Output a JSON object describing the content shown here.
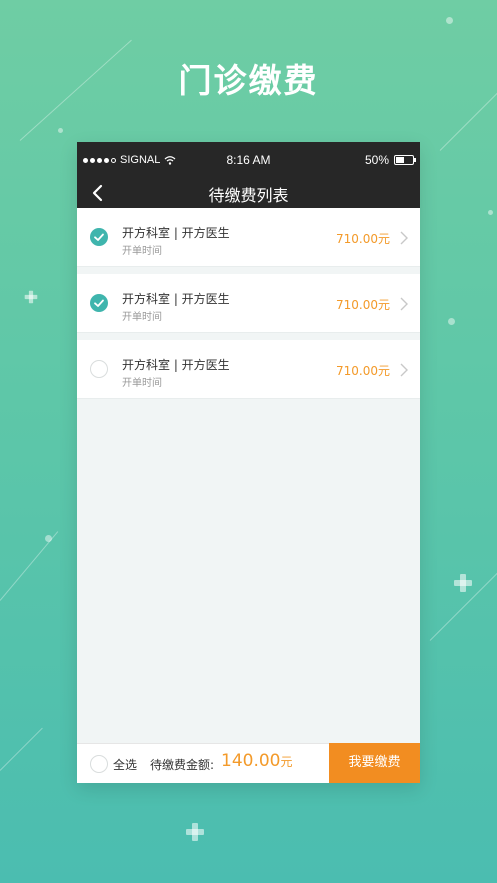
{
  "headline": "门诊缴费",
  "status_bar": {
    "carrier": "SIGNAL",
    "time": "8:16 AM",
    "battery": "50%"
  },
  "nav": {
    "title": "待缴费列表",
    "back_icon": "chevron-left-icon"
  },
  "items": [
    {
      "title": "开方科室 | 开方医生",
      "subtitle": "开单时间",
      "amount": "710.00元",
      "checked": true
    },
    {
      "title": "开方科室 | 开方医生",
      "subtitle": "开单时间",
      "amount": "710.00元",
      "checked": true
    },
    {
      "title": "开方科室 | 开方医生",
      "subtitle": "开单时间",
      "amount": "710.00元",
      "checked": false
    }
  ],
  "footer": {
    "select_all_label": "全选",
    "due_label": "待缴费金额:",
    "due_amount": "140.00",
    "due_unit": "元",
    "pay_button": "我要缴费"
  },
  "colors": {
    "accent_teal": "#3fb5ad",
    "amount_orange": "#f39a2a",
    "pay_orange": "#f28d21",
    "bar_dark": "#272727"
  }
}
